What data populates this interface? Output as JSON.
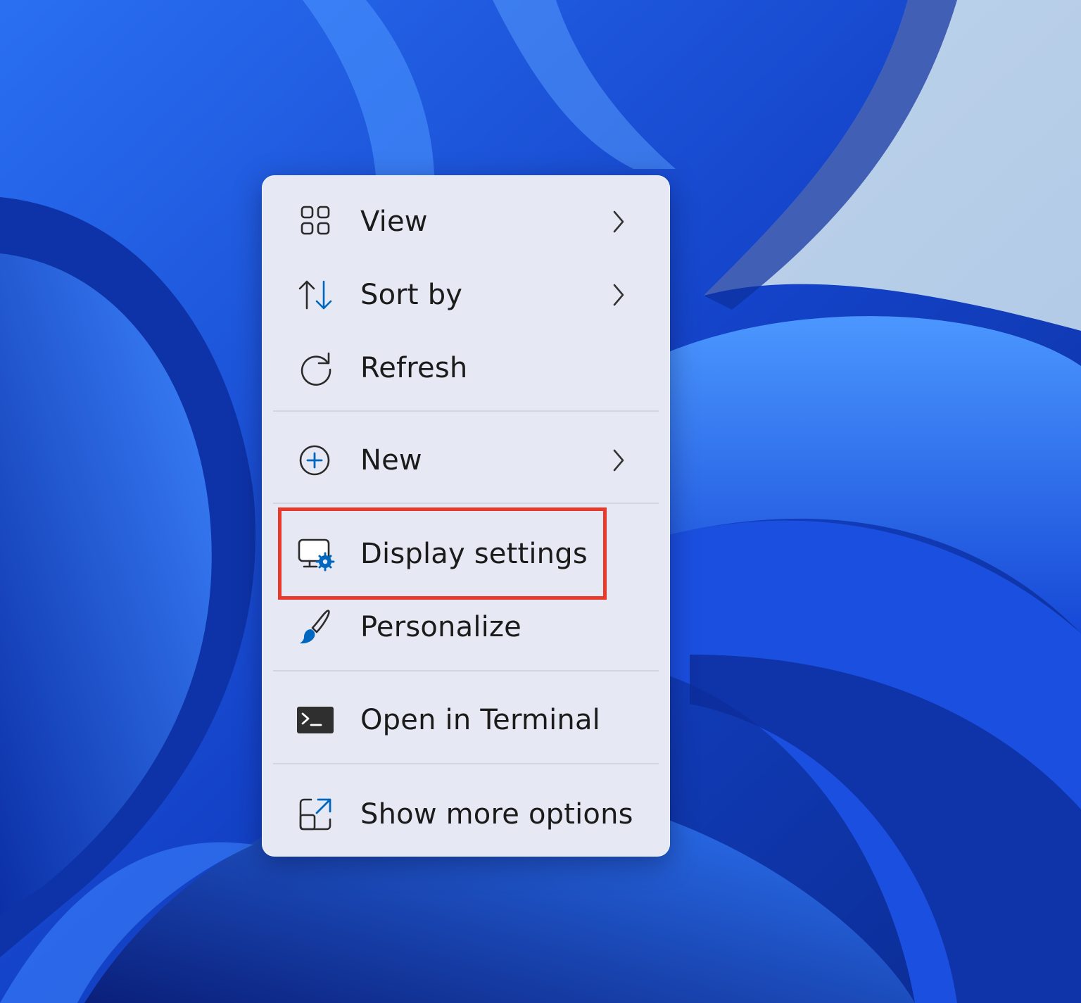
{
  "context_menu": {
    "items": [
      {
        "label": "View",
        "icon": "grid-view-icon",
        "has_submenu": true
      },
      {
        "label": "Sort by",
        "icon": "sort-arrows-icon",
        "has_submenu": true
      },
      {
        "label": "Refresh",
        "icon": "refresh-icon",
        "has_submenu": false
      },
      {
        "label": "New",
        "icon": "plus-circle-icon",
        "has_submenu": true
      },
      {
        "label": "Display settings",
        "icon": "display-settings-icon",
        "has_submenu": false
      },
      {
        "label": "Personalize",
        "icon": "paintbrush-icon",
        "has_submenu": false
      },
      {
        "label": "Open in Terminal",
        "icon": "terminal-icon",
        "has_submenu": false
      },
      {
        "label": "Show more options",
        "icon": "show-more-options-icon",
        "has_submenu": false
      }
    ],
    "highlighted_item": "Display settings"
  },
  "colors": {
    "menu_background": "#e6e9f3",
    "highlight_border": "#e8392a",
    "accent_blue": "#0067c0",
    "wallpaper_blue": "#1a4fd8"
  }
}
